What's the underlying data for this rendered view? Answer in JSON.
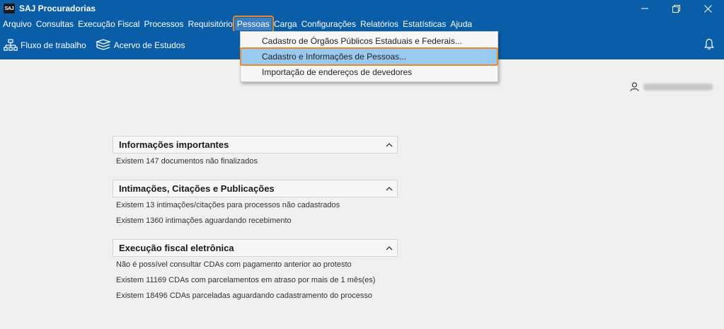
{
  "window": {
    "logo_text": "SAJ",
    "title": "SAJ Procuradorias"
  },
  "menubar": {
    "items": [
      "Arquivo",
      "Consultas",
      "Execução Fiscal",
      "Processos",
      "Requisitório",
      "Pessoas",
      "Carga",
      "Configurações",
      "Relatórios",
      "Estatísticas",
      "Ajuda"
    ],
    "open_item": "Pessoas"
  },
  "toolbar": {
    "workflow_label": "Fluxo de trabalho",
    "studies_label": "Acervo de Estudos"
  },
  "dropdown": {
    "items": [
      "Cadastro de Órgãos Públicos Estaduais e Federais...",
      "Cadastro e Informações de Pessoas...",
      "Importação de endereços de devedores"
    ],
    "highlighted_index": 1
  },
  "panels": [
    {
      "title": "Informações importantes",
      "lines": [
        "Existem  147 documentos não finalizados"
      ]
    },
    {
      "title": "Intimações, Citações e Publicações",
      "lines": [
        "Existem  13 intimações/citações para processos não cadastrados",
        "Existem  1360 intimações aguardando recebimento"
      ]
    },
    {
      "title": "Execução fiscal eletrônica",
      "lines": [
        "Não é possível consultar CDAs com pagamento anterior ao protesto",
        "Existem  11169 CDAs com parcelamentos em atraso por mais de 1 mês(es)",
        "Existem  18496 CDAs parceladas aguardando cadastramento do processo"
      ]
    }
  ],
  "colors": {
    "header_blue": "#0a5ea8",
    "menu_highlight": "#99c9ef",
    "callout_orange": "#e8892c"
  }
}
